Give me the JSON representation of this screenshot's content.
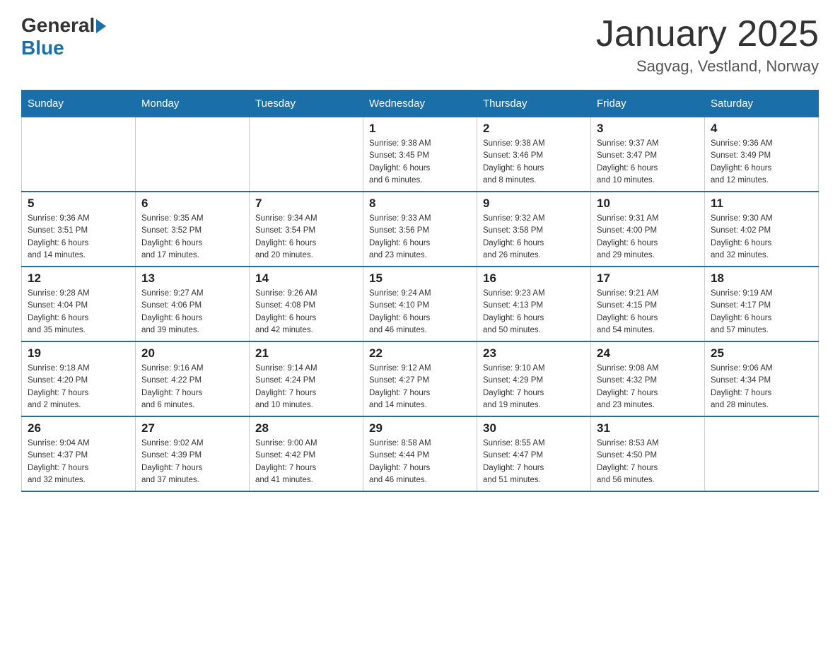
{
  "header": {
    "logo_general": "General",
    "logo_blue": "Blue",
    "month_title": "January 2025",
    "location": "Sagvag, Vestland, Norway"
  },
  "days_of_week": [
    "Sunday",
    "Monday",
    "Tuesday",
    "Wednesday",
    "Thursday",
    "Friday",
    "Saturday"
  ],
  "weeks": [
    [
      {
        "day": "",
        "info": ""
      },
      {
        "day": "",
        "info": ""
      },
      {
        "day": "",
        "info": ""
      },
      {
        "day": "1",
        "info": "Sunrise: 9:38 AM\nSunset: 3:45 PM\nDaylight: 6 hours\nand 6 minutes."
      },
      {
        "day": "2",
        "info": "Sunrise: 9:38 AM\nSunset: 3:46 PM\nDaylight: 6 hours\nand 8 minutes."
      },
      {
        "day": "3",
        "info": "Sunrise: 9:37 AM\nSunset: 3:47 PM\nDaylight: 6 hours\nand 10 minutes."
      },
      {
        "day": "4",
        "info": "Sunrise: 9:36 AM\nSunset: 3:49 PM\nDaylight: 6 hours\nand 12 minutes."
      }
    ],
    [
      {
        "day": "5",
        "info": "Sunrise: 9:36 AM\nSunset: 3:51 PM\nDaylight: 6 hours\nand 14 minutes."
      },
      {
        "day": "6",
        "info": "Sunrise: 9:35 AM\nSunset: 3:52 PM\nDaylight: 6 hours\nand 17 minutes."
      },
      {
        "day": "7",
        "info": "Sunrise: 9:34 AM\nSunset: 3:54 PM\nDaylight: 6 hours\nand 20 minutes."
      },
      {
        "day": "8",
        "info": "Sunrise: 9:33 AM\nSunset: 3:56 PM\nDaylight: 6 hours\nand 23 minutes."
      },
      {
        "day": "9",
        "info": "Sunrise: 9:32 AM\nSunset: 3:58 PM\nDaylight: 6 hours\nand 26 minutes."
      },
      {
        "day": "10",
        "info": "Sunrise: 9:31 AM\nSunset: 4:00 PM\nDaylight: 6 hours\nand 29 minutes."
      },
      {
        "day": "11",
        "info": "Sunrise: 9:30 AM\nSunset: 4:02 PM\nDaylight: 6 hours\nand 32 minutes."
      }
    ],
    [
      {
        "day": "12",
        "info": "Sunrise: 9:28 AM\nSunset: 4:04 PM\nDaylight: 6 hours\nand 35 minutes."
      },
      {
        "day": "13",
        "info": "Sunrise: 9:27 AM\nSunset: 4:06 PM\nDaylight: 6 hours\nand 39 minutes."
      },
      {
        "day": "14",
        "info": "Sunrise: 9:26 AM\nSunset: 4:08 PM\nDaylight: 6 hours\nand 42 minutes."
      },
      {
        "day": "15",
        "info": "Sunrise: 9:24 AM\nSunset: 4:10 PM\nDaylight: 6 hours\nand 46 minutes."
      },
      {
        "day": "16",
        "info": "Sunrise: 9:23 AM\nSunset: 4:13 PM\nDaylight: 6 hours\nand 50 minutes."
      },
      {
        "day": "17",
        "info": "Sunrise: 9:21 AM\nSunset: 4:15 PM\nDaylight: 6 hours\nand 54 minutes."
      },
      {
        "day": "18",
        "info": "Sunrise: 9:19 AM\nSunset: 4:17 PM\nDaylight: 6 hours\nand 57 minutes."
      }
    ],
    [
      {
        "day": "19",
        "info": "Sunrise: 9:18 AM\nSunset: 4:20 PM\nDaylight: 7 hours\nand 2 minutes."
      },
      {
        "day": "20",
        "info": "Sunrise: 9:16 AM\nSunset: 4:22 PM\nDaylight: 7 hours\nand 6 minutes."
      },
      {
        "day": "21",
        "info": "Sunrise: 9:14 AM\nSunset: 4:24 PM\nDaylight: 7 hours\nand 10 minutes."
      },
      {
        "day": "22",
        "info": "Sunrise: 9:12 AM\nSunset: 4:27 PM\nDaylight: 7 hours\nand 14 minutes."
      },
      {
        "day": "23",
        "info": "Sunrise: 9:10 AM\nSunset: 4:29 PM\nDaylight: 7 hours\nand 19 minutes."
      },
      {
        "day": "24",
        "info": "Sunrise: 9:08 AM\nSunset: 4:32 PM\nDaylight: 7 hours\nand 23 minutes."
      },
      {
        "day": "25",
        "info": "Sunrise: 9:06 AM\nSunset: 4:34 PM\nDaylight: 7 hours\nand 28 minutes."
      }
    ],
    [
      {
        "day": "26",
        "info": "Sunrise: 9:04 AM\nSunset: 4:37 PM\nDaylight: 7 hours\nand 32 minutes."
      },
      {
        "day": "27",
        "info": "Sunrise: 9:02 AM\nSunset: 4:39 PM\nDaylight: 7 hours\nand 37 minutes."
      },
      {
        "day": "28",
        "info": "Sunrise: 9:00 AM\nSunset: 4:42 PM\nDaylight: 7 hours\nand 41 minutes."
      },
      {
        "day": "29",
        "info": "Sunrise: 8:58 AM\nSunset: 4:44 PM\nDaylight: 7 hours\nand 46 minutes."
      },
      {
        "day": "30",
        "info": "Sunrise: 8:55 AM\nSunset: 4:47 PM\nDaylight: 7 hours\nand 51 minutes."
      },
      {
        "day": "31",
        "info": "Sunrise: 8:53 AM\nSunset: 4:50 PM\nDaylight: 7 hours\nand 56 minutes."
      },
      {
        "day": "",
        "info": ""
      }
    ]
  ]
}
